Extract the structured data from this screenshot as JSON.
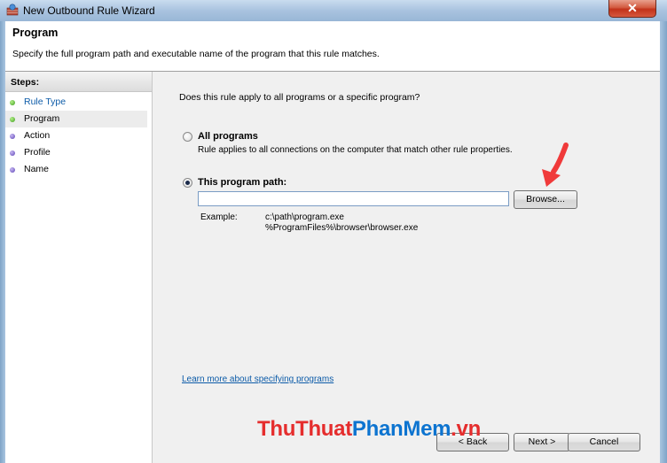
{
  "window": {
    "title": "New Outbound Rule Wizard",
    "close_label": "✕"
  },
  "header": {
    "title": "Program",
    "description": "Specify the full program path and executable name of the program that this rule matches."
  },
  "sidebar": {
    "header": "Steps:",
    "items": [
      {
        "label": "Rule Type",
        "state": "done-link"
      },
      {
        "label": "Program",
        "state": "current"
      },
      {
        "label": "Action",
        "state": "pending"
      },
      {
        "label": "Profile",
        "state": "pending"
      },
      {
        "label": "Name",
        "state": "pending"
      }
    ]
  },
  "main": {
    "question": "Does this rule apply to all programs or a specific program?",
    "option_all": {
      "label": "All programs",
      "description": "Rule applies to all connections on the computer that match other rule properties.",
      "selected": false
    },
    "option_path": {
      "label": "This program path:",
      "selected": true,
      "value": "",
      "placeholder": ""
    },
    "browse_label": "Browse...",
    "example": {
      "label": "Example:",
      "lines": [
        "c:\\path\\program.exe",
        "%ProgramFiles%\\browser\\browser.exe"
      ]
    },
    "learn_more": "Learn more about specifying programs"
  },
  "footer": {
    "back_label": "< Back",
    "next_label": "Next >",
    "cancel_label": "Cancel"
  },
  "watermark": {
    "part1": "ThuThuat",
    "part2": "PhanMem",
    "part3": ".vn"
  },
  "colors": {
    "link": "#0c5ba8",
    "arrow": "#f03a3a",
    "step_done": "#3c9c1c",
    "step_pending": "#5a42b5"
  }
}
